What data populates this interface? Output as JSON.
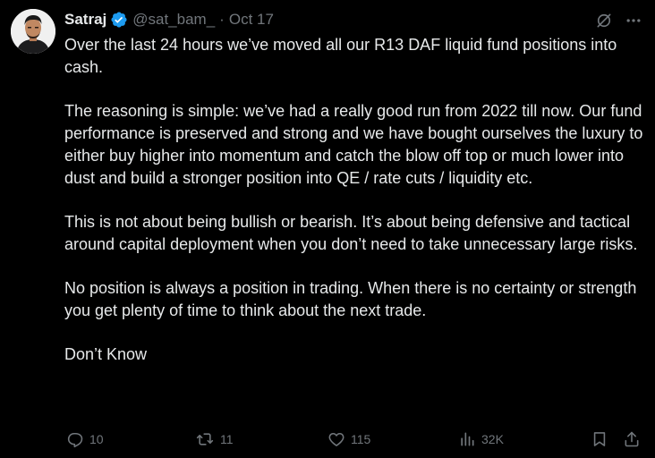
{
  "author": {
    "name": "Satraj",
    "handle": "@sat_bam_",
    "separator": "·",
    "date": "Oct 17"
  },
  "tweet": {
    "paragraphs": [
      "Over the last 24 hours we’ve moved all our R13 DAF liquid fund positions into cash.",
      "The reasoning is simple: we’ve had a really good run from 2022 till now. Our fund performance is preserved and strong and we have bought ourselves the luxury to either buy higher into momentum and catch the blow off top or much lower into dust and build a stronger position into QE / rate cuts / liquidity etc.",
      "This is not about being bullish or bearish. It’s about being defensive and tactical around capital deployment when you don’t need to take unnecessary large risks.",
      "No position is always a position in trading. When there is no certainty or strength you get plenty of time to think about the next trade.",
      "Don’t Know"
    ]
  },
  "actions": {
    "replies": "10",
    "reposts": "11",
    "likes": "115",
    "views": "32K"
  },
  "icons": {
    "verified": "verified-badge-icon",
    "grok": "grok-icon",
    "more": "more-icon",
    "reply": "reply-icon",
    "repost": "repost-icon",
    "like": "like-icon",
    "views": "views-icon",
    "bookmark": "bookmark-icon",
    "share": "share-icon"
  },
  "colors": {
    "background": "#000000",
    "text": "#e7e9ea",
    "secondary": "#71767b",
    "verified": "#1d9bf0"
  }
}
